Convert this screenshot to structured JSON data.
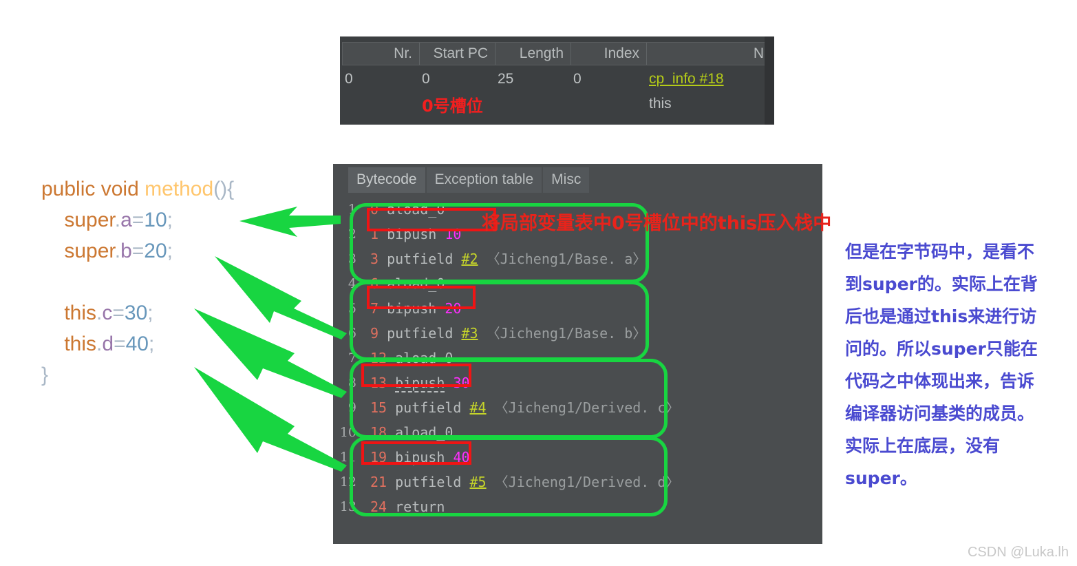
{
  "local_variable_table": {
    "columns": [
      "Nr.",
      "Start PC",
      "Length",
      "Index",
      "N"
    ],
    "rows": [
      {
        "nr": "0",
        "start_pc": "0",
        "length": "25",
        "index": "0",
        "name_link": "cp_info #18",
        "name_value": "this"
      }
    ],
    "annotation_slot": "0号槽位"
  },
  "source_code": {
    "lines": [
      {
        "id": "l1",
        "parts": [
          {
            "t": "public void ",
            "c": "kw"
          },
          {
            "t": "method",
            "c": "mname"
          },
          {
            "t": "(){",
            "c": "punc"
          }
        ]
      },
      {
        "id": "l2",
        "parts": [
          {
            "t": "    ",
            "c": "punc"
          },
          {
            "t": "super",
            "c": "ident"
          },
          {
            "t": ".",
            "c": "punc"
          },
          {
            "t": "a",
            "c": "fld"
          },
          {
            "t": "=",
            "c": "punc"
          },
          {
            "t": "10",
            "c": "num"
          },
          {
            "t": ";",
            "c": "punc"
          }
        ]
      },
      {
        "id": "l3",
        "parts": [
          {
            "t": "    ",
            "c": "punc"
          },
          {
            "t": "super",
            "c": "ident"
          },
          {
            "t": ".",
            "c": "punc"
          },
          {
            "t": "b",
            "c": "fld"
          },
          {
            "t": "=",
            "c": "punc"
          },
          {
            "t": "20",
            "c": "num"
          },
          {
            "t": ";",
            "c": "punc"
          }
        ]
      },
      {
        "id": "l4",
        "parts": [
          {
            "t": " ",
            "c": "punc"
          }
        ]
      },
      {
        "id": "l5",
        "parts": [
          {
            "t": "    ",
            "c": "punc"
          },
          {
            "t": "this",
            "c": "ident"
          },
          {
            "t": ".",
            "c": "punc"
          },
          {
            "t": "c",
            "c": "fld"
          },
          {
            "t": "=",
            "c": "punc"
          },
          {
            "t": "30",
            "c": "num"
          },
          {
            "t": ";",
            "c": "punc"
          }
        ]
      },
      {
        "id": "l6",
        "parts": [
          {
            "t": "    ",
            "c": "punc"
          },
          {
            "t": "this",
            "c": "ident"
          },
          {
            "t": ".",
            "c": "punc"
          },
          {
            "t": "d",
            "c": "fld"
          },
          {
            "t": "=",
            "c": "punc"
          },
          {
            "t": "40",
            "c": "num"
          },
          {
            "t": ";",
            "c": "punc"
          }
        ]
      },
      {
        "id": "l7",
        "parts": [
          {
            "t": "}",
            "c": "punc"
          }
        ]
      }
    ]
  },
  "bytecode_panel": {
    "tabs": [
      {
        "label": "Bytecode",
        "active": true
      },
      {
        "label": "Exception table",
        "active": false
      },
      {
        "label": "Misc",
        "active": false
      }
    ],
    "gutter_numbers": [
      "1",
      "2",
      "3",
      "4",
      "5",
      "6",
      "7",
      "8",
      "9",
      "10",
      "11",
      "12",
      "13"
    ],
    "instructions": [
      {
        "offset": "0",
        "op": "aload_0",
        "arg": "",
        "ref": "",
        "desc": ""
      },
      {
        "offset": "1",
        "op": "bipush",
        "arg": "10",
        "ref": "",
        "desc": ""
      },
      {
        "offset": "3",
        "op": "putfield",
        "arg": "",
        "ref": "#2",
        "desc": "〈Jicheng1/Base. a〉"
      },
      {
        "offset": "6",
        "op": "aload_0",
        "arg": "",
        "ref": "",
        "desc": ""
      },
      {
        "offset": "7",
        "op": "bipush",
        "arg": "20",
        "ref": "",
        "desc": ""
      },
      {
        "offset": "9",
        "op": "putfield",
        "arg": "",
        "ref": "#3",
        "desc": "〈Jicheng1/Base. b〉"
      },
      {
        "offset": "12",
        "op": "aload_0",
        "arg": "",
        "ref": "",
        "desc": ""
      },
      {
        "offset": "13",
        "op": "bipush",
        "arg": "30",
        "ref": "",
        "desc": ""
      },
      {
        "offset": "15",
        "op": "putfield",
        "arg": "",
        "ref": "#4",
        "desc": "〈Jicheng1/Derived. c〉"
      },
      {
        "offset": "18",
        "op": "aload_0",
        "arg": "",
        "ref": "",
        "desc": ""
      },
      {
        "offset": "19",
        "op": "bipush",
        "arg": "40",
        "ref": "",
        "desc": ""
      },
      {
        "offset": "21",
        "op": "putfield",
        "arg": "",
        "ref": "#5",
        "desc": "〈Jicheng1/Derived. d〉"
      },
      {
        "offset": "24",
        "op": "return",
        "arg": "",
        "ref": "",
        "desc": ""
      }
    ],
    "annotation": "将局部变量表中0号槽位中的this压入栈中"
  },
  "right_note": {
    "text": "但是在字节码中，是看不到super的。实际上在背后也是通过this来进行访问的。所以super只能在代码之中体现出来，告诉编译器访问基类的成员。实际上在底层，没有super。"
  },
  "watermark": {
    "text": "CSDN @Luka.lh"
  },
  "colors": {
    "panel_bg": "#4a4d4f",
    "table_bg": "#3c3f41",
    "highlight_green": "#18d541",
    "highlight_red": "#f01414",
    "annotation_red": "#e8231b",
    "note_blue": "#4a4ad0",
    "cp_ref": "#c5d42a",
    "literal_magenta": "#ff2fff",
    "offset_salmon": "#e0705f"
  }
}
